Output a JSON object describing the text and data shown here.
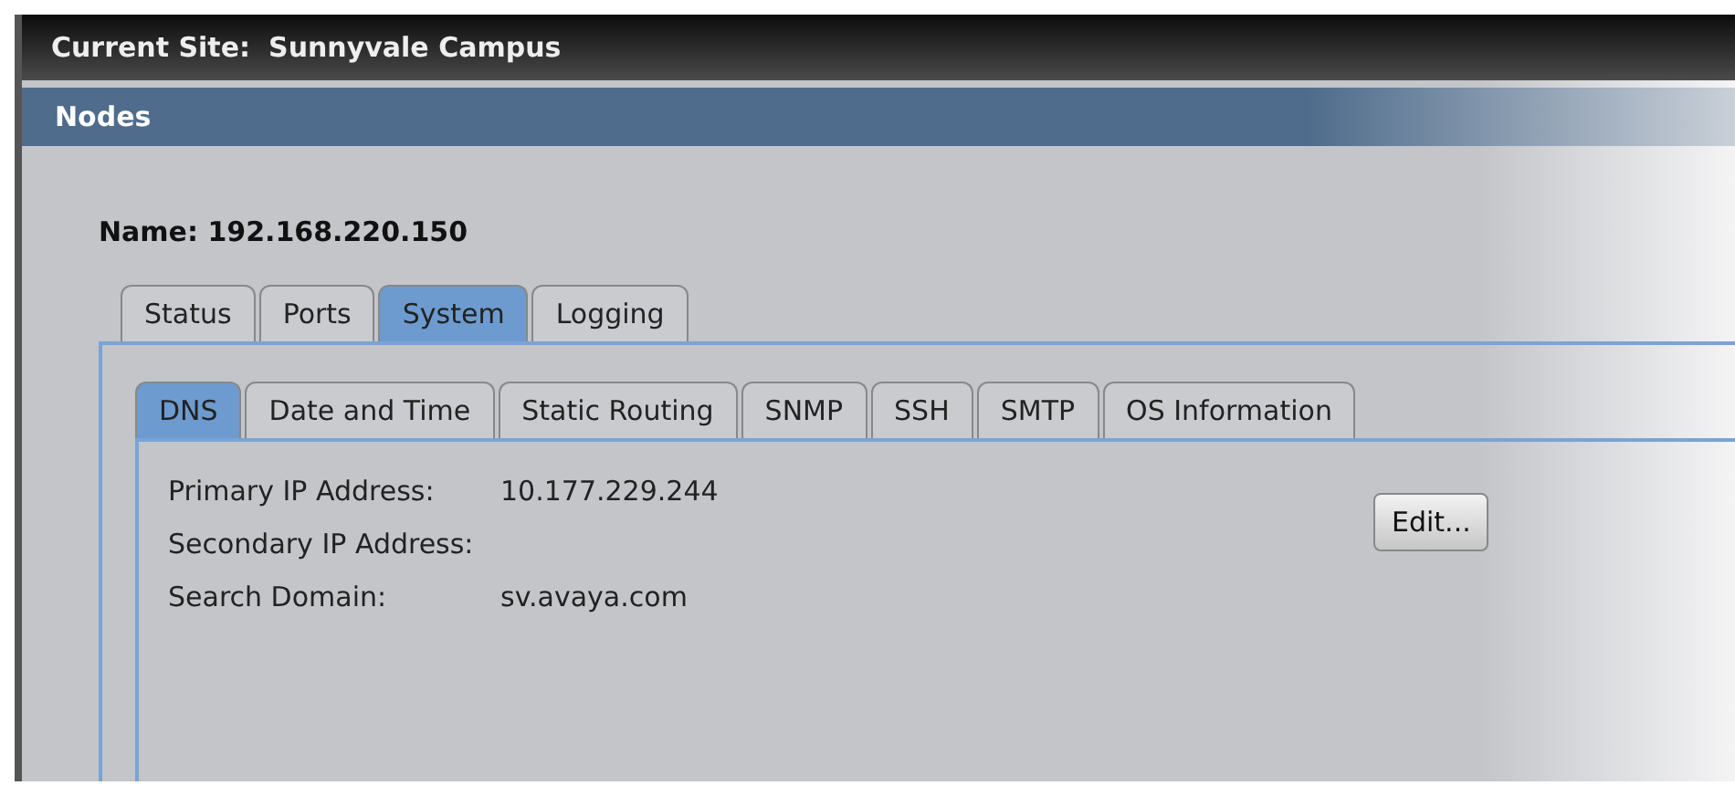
{
  "site_bar": {
    "label": "Current Site:",
    "value": "Sunnyvale Campus"
  },
  "panel": {
    "title": "Nodes"
  },
  "node_name": "Name: 192.168.220.150",
  "tabs": [
    {
      "label": "Status",
      "selected": false
    },
    {
      "label": "Ports",
      "selected": false
    },
    {
      "label": "System",
      "selected": true
    },
    {
      "label": "Logging",
      "selected": false
    }
  ],
  "sub_tabs": [
    {
      "label": "DNS",
      "selected": true
    },
    {
      "label": "Date and Time",
      "selected": false
    },
    {
      "label": "Static Routing",
      "selected": false
    },
    {
      "label": "SNMP",
      "selected": false
    },
    {
      "label": "SSH",
      "selected": false
    },
    {
      "label": "SMTP",
      "selected": false
    },
    {
      "label": "OS Information",
      "selected": false
    }
  ],
  "fields": [
    {
      "label": "Primary IP Address:",
      "value": "10.177.229.244"
    },
    {
      "label": "Secondary IP Address:"
    },
    {
      "label": "Search Domain:",
      "value": "sv.avaya.com"
    }
  ],
  "edit_button": "Edit..."
}
